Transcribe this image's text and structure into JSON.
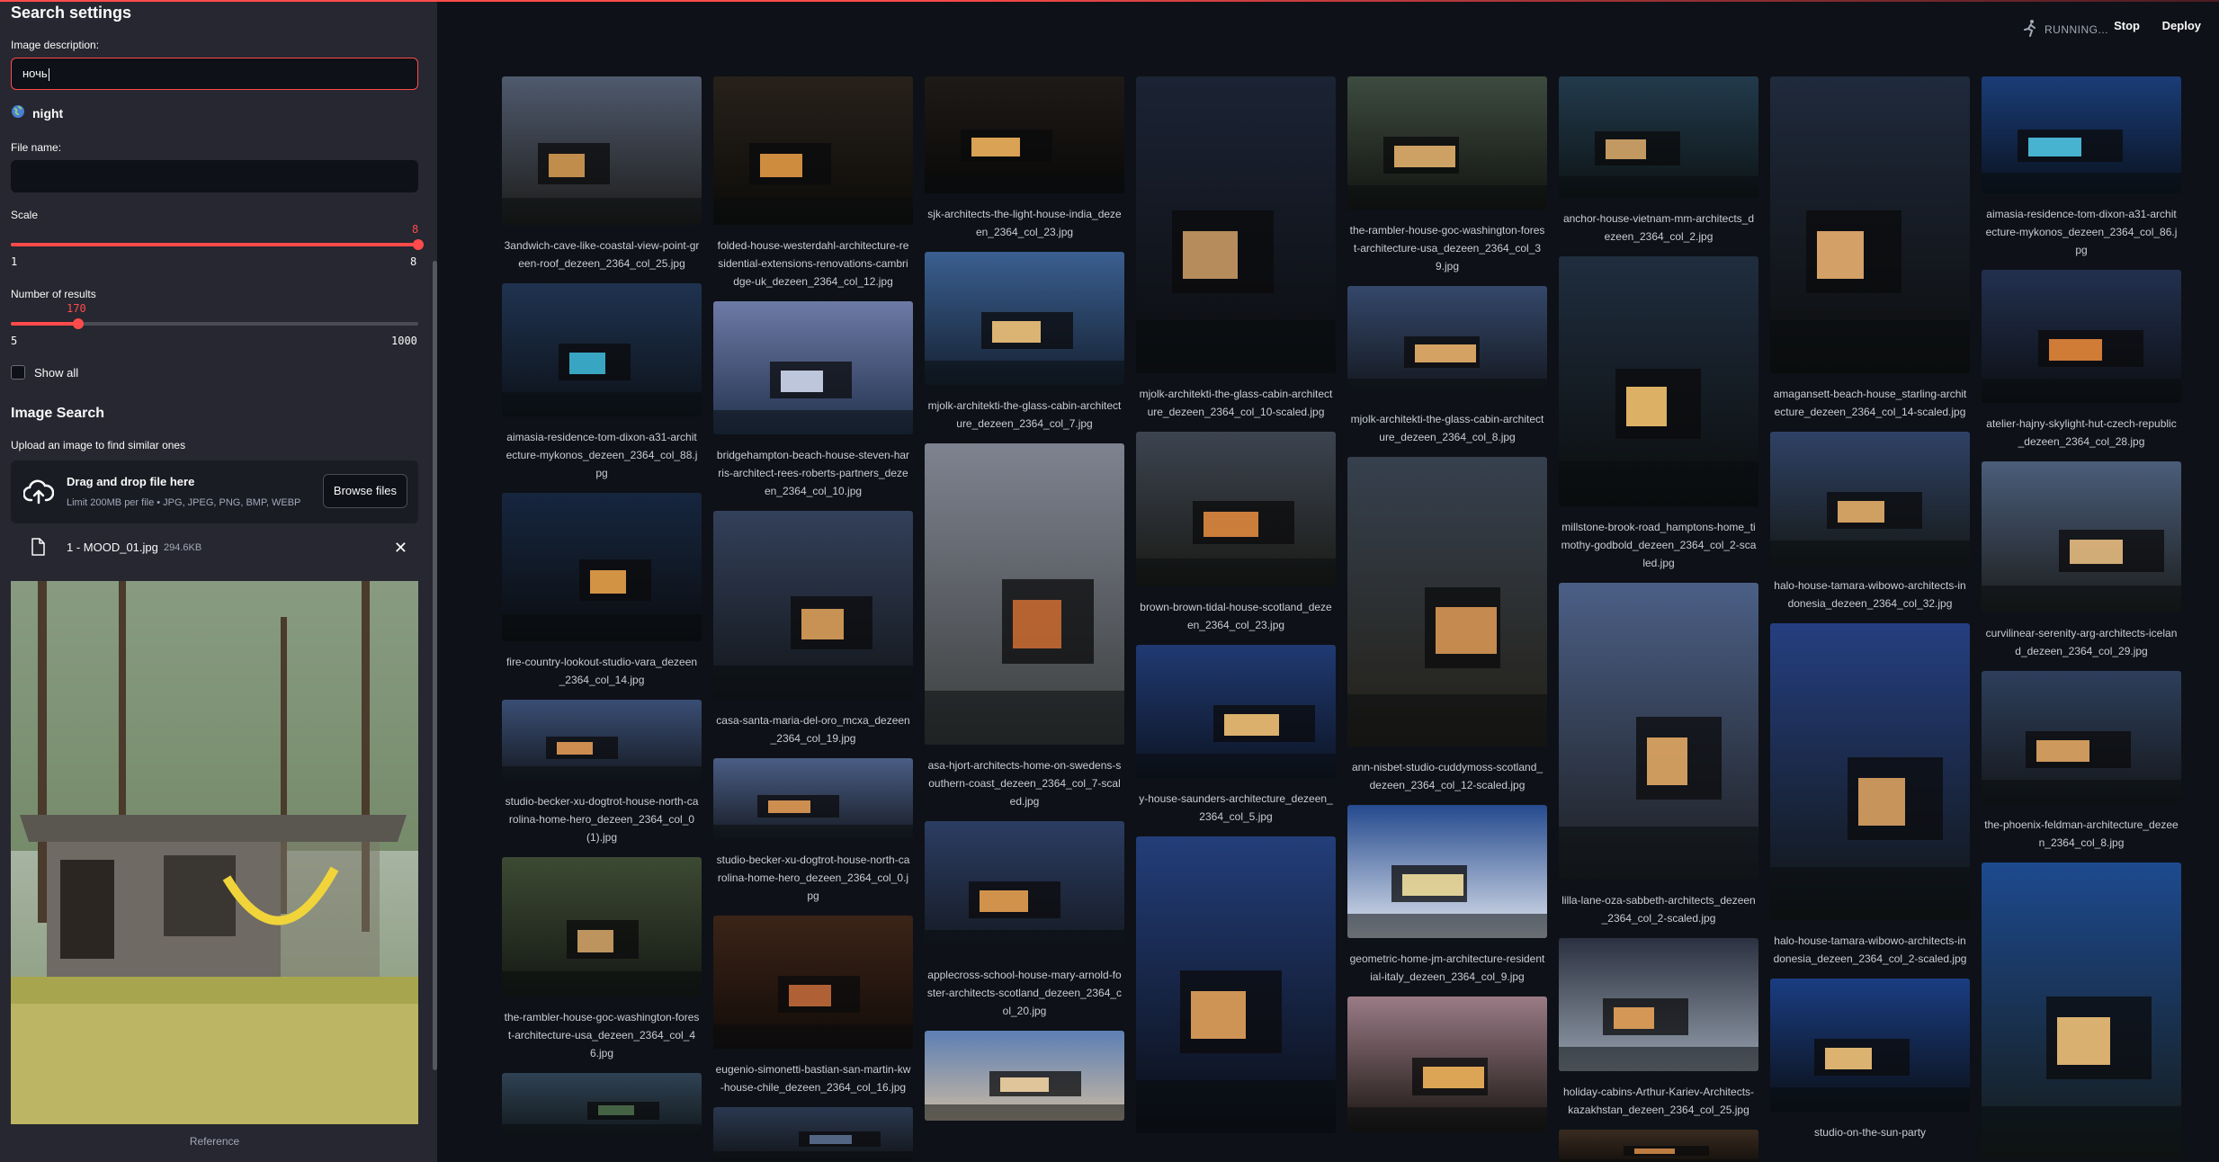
{
  "sidebar": {
    "title": "Search settings",
    "image_description_label": "Image description:",
    "image_description_value": "ночь",
    "suggestion": "night",
    "file_name_label": "File name:",
    "file_name_value": "",
    "scale": {
      "label": "Scale",
      "value": "8",
      "min": "1",
      "max": "8",
      "fraction": 1.0
    },
    "num_results": {
      "label": "Number of results",
      "value": "170",
      "min": "5",
      "max": "1000",
      "fraction": 0.166
    },
    "show_all_label": "Show all",
    "image_search_title": "Image Search",
    "upload_label": "Upload an image to find similar ones",
    "uploader_main": "Drag and drop file here",
    "uploader_sub": "Limit 200MB per file • JPG, JPEG, PNG, BMP, WEBP",
    "browse_label": "Browse files",
    "file": {
      "name": "1 - MOOD_01.jpg",
      "size": "294.6KB"
    },
    "reference_caption": "Reference"
  },
  "header": {
    "running_label": "RUNNING...",
    "stop_label": "Stop",
    "deploy_label": "Deploy"
  },
  "icons": {
    "suggestion": "globe-icon",
    "uploader": "cloud-upload-icon",
    "file": "file-icon",
    "remove": "close-icon",
    "running": "running-figure-icon"
  },
  "colors": {
    "accent": "#ff4b4b",
    "background": "#0e1117",
    "sidebar": "#262730"
  },
  "gallery": {
    "columns": [
      [
        {
          "caption": "3andwich-cave-like-coastal-view-point-green-roof_dezeen_2364_col_25.jpg",
          "h": 165,
          "c1": "#4f5a6e",
          "c2": "#1d1c1a",
          "glow": "#d49a52"
        },
        {
          "caption": "aimasia-residence-tom-dixon-a31-architecture-mykonos_dezeen_2364_col_88.jpg",
          "h": 148,
          "c1": "#1f3350",
          "c2": "#0c1118",
          "glow": "#3db6d6"
        },
        {
          "caption": "fire-country-lookout-studio-vara_dezeen_2364_col_14.jpg",
          "h": 165,
          "c1": "#16263f",
          "c2": "#0b0d10",
          "glow": "#e8a24b"
        },
        {
          "caption": "studio-becker-xu-dogtrot-house-north-carolina-home-hero_dezeen_2364_col_0 (1).jpg",
          "h": 90,
          "c1": "#3a4e74",
          "c2": "#151a22",
          "glow": "#e39b57"
        },
        {
          "caption": "the-rambler-house-goc-washington-forest-architecture-usa_dezeen_2364_col_46.jpg",
          "h": 155,
          "c1": "#3c4a33",
          "c2": "#151813",
          "glow": "#d0a366"
        },
        {
          "caption": "",
          "h": 70,
          "c1": "#2f4253",
          "c2": "#12181c",
          "glow": "#4b6b4a"
        }
      ],
      [
        {
          "caption": "folded-house-westerdahl-architecture-residential-extensions-renovations-cambridge-uk_dezeen_2364_col_12.jpg",
          "h": 165,
          "c1": "#27211a",
          "c2": "#0c0b09",
          "glow": "#e39a45"
        },
        {
          "caption": "bridgehampton-beach-house-steven-harris-architect-rees-roberts-partners_dezeen_2364_col_10.jpg",
          "h": 148,
          "c1": "#6d7aa6",
          "c2": "#22324e",
          "glow": "#cfd9ef"
        },
        {
          "caption": "casa-santa-maria-del-oro_mcxa_dezeen_2364_col_19.jpg",
          "h": 210,
          "c1": "#33405a",
          "c2": "#121519",
          "glow": "#dba15a"
        },
        {
          "caption": "studio-becker-xu-dogtrot-house-north-carolina-home-hero_dezeen_2364_col_0.jpg",
          "h": 90,
          "c1": "#4a5d85",
          "c2": "#171c24",
          "glow": "#e39b57"
        },
        {
          "caption": "eugenio-simonetti-bastian-san-martin-kw-house-chile_dezeen_2364_col_16.jpg",
          "h": 148,
          "c1": "#3b2418",
          "c2": "#120b08",
          "glow": "#c16a3a"
        },
        {
          "caption": "",
          "h": 60,
          "c1": "#2a3850",
          "c2": "#121519",
          "glow": "#5a6f8e"
        }
      ],
      [
        {
          "caption": "sjk-architects-the-light-house-india_dezeen_2364_col_23.jpg",
          "h": 130,
          "c1": "#1e1a17",
          "c2": "#0a0908",
          "glow": "#f0b25c"
        },
        {
          "caption": "mjolk-architekti-the-glass-cabin-architecture_dezeen_2364_col_7.jpg",
          "h": 148,
          "c1": "#3a5f90",
          "c2": "#152132",
          "glow": "#f2c47c"
        },
        {
          "caption": "asa-hjort-architects-home-on-swedens-southern-coast_dezeen_2364_col_7-scaled.jpg",
          "h": 335,
          "c1": "#7e8390",
          "c2": "#3b3d3c",
          "glow": "#c76a33"
        },
        {
          "caption": "applecross-school-house-mary-arnold-foster-architects-scotland_dezeen_2364_col_20.jpg",
          "h": 148,
          "c1": "#2b3d63",
          "c2": "#141820",
          "glow": "#e7a252"
        },
        {
          "caption": "",
          "h": 100,
          "c1": "#5d7fb4",
          "c2": "#c9b9a2",
          "glow": "#f4d6a6"
        }
      ],
      [
        {
          "caption": "mjolk-architekti-the-glass-cabin-architecture_dezeen_2364_col_10-scaled.jpg",
          "h": 330,
          "c1": "#1b2334",
          "c2": "#0c0d10",
          "glow": "#c99a66"
        },
        {
          "caption": "brown-brown-tidal-house-scotland_dezeen_2364_col_23.jpg",
          "h": 172,
          "c1": "#3c4450",
          "c2": "#1a1a16",
          "glow": "#e08a3f"
        },
        {
          "caption": "y-house-saunders-architecture_dezeen_2364_col_5.jpg",
          "h": 148,
          "c1": "#203a72",
          "c2": "#0d1423",
          "glow": "#f2c276"
        },
        {
          "caption": "",
          "h": 330,
          "c1": "#233e7a",
          "c2": "#0a0c12",
          "glow": "#e3a35d"
        }
      ],
      [
        {
          "caption": "the-rambler-house-goc-washington-forest-architecture-usa_dezeen_2364_col_39.jpg",
          "h": 148,
          "c1": "#3d4b3f",
          "c2": "#121410",
          "glow": "#e2b16d"
        },
        {
          "caption": "mjolk-architekti-the-glass-cabin-architecture_dezeen_2364_col_8.jpg",
          "h": 125,
          "c1": "#34486b",
          "c2": "#13161c",
          "glow": "#eab46c"
        },
        {
          "caption": "ann-nisbet-studio-cuddymoss-scotland_dezeen_2364_col_12-scaled.jpg",
          "h": 322,
          "c1": "#36404e",
          "c2": "#232017",
          "glow": "#d99855"
        },
        {
          "caption": "geometric-home-jm-architecture-residential-italy_dezeen_2364_col_9.jpg",
          "h": 148,
          "c1": "#254a8e",
          "c2": "#dfe5ef",
          "glow": "#f2e0a1"
        },
        {
          "caption": "",
          "h": 150,
          "c1": "#9a7b86",
          "c2": "#181410",
          "glow": "#f2b55c"
        }
      ],
      [
        {
          "caption": "anchor-house-vietnam-mm-architects_dezeen_2364_col_2.jpg",
          "h": 135,
          "c1": "#223a4c",
          "c2": "#0d1416",
          "glow": "#d7a86c"
        },
        {
          "caption": "millstone-brook-road_hamptons-home_timothy-godbold_dezeen_2364_col_2-scaled.jpg",
          "h": 278,
          "c1": "#1f2d3e",
          "c2": "#0b0d0d",
          "glow": "#f3c26f"
        },
        {
          "caption": "lilla-lane-oza-sabbeth-architects_dezeen_2364_col_2-scaled.jpg",
          "h": 330,
          "c1": "#4b5f86",
          "c2": "#1c1e21",
          "glow": "#e3aa66"
        },
        {
          "caption": "holiday-cabins-Arthur-Kariev-Architects-kazakhstan_dezeen_2364_col_25.jpg",
          "h": 148,
          "c1": "#2b3140",
          "c2": "#96a0ad",
          "glow": "#e8a45b"
        },
        {
          "caption": "",
          "h": 40,
          "c1": "#3a2b20",
          "c2": "#120e0b",
          "glow": "#d08a48"
        }
      ],
      [
        {
          "caption": "amagansett-beach-house_starling-architecture_dezeen_2364_col_14-scaled.jpg",
          "h": 330,
          "c1": "#1f2a3c",
          "c2": "#0d0d0d",
          "glow": "#e9b071"
        },
        {
          "caption": "halo-house-tamara-wibowo-architects-indonesia_dezeen_2364_col_32.jpg",
          "h": 148,
          "c1": "#2f4266",
          "c2": "#151918",
          "glow": "#e6b06c"
        },
        {
          "caption": "halo-house-tamara-wibowo-architects-indonesia_dezeen_2364_col_2-scaled.jpg",
          "h": 330,
          "c1": "#253f80",
          "c2": "#111412",
          "glow": "#dca364"
        },
        {
          "caption": "studio-on-the-sun-party",
          "h": 148,
          "c1": "#1a3d82",
          "c2": "#0b0f16",
          "glow": "#f2c47a"
        }
      ],
      [
        {
          "caption": "aimasia-residence-tom-dixon-a31-architecture-mykonos_dezeen_2364_col_86.jpg",
          "h": 130,
          "c1": "#1a3d78",
          "c2": "#0a1220",
          "glow": "#4ec5e6"
        },
        {
          "caption": "atelier-hajny-skylight-hut-czech-republic_dezeen_2364_col_28.jpg",
          "h": 148,
          "c1": "#22304f",
          "c2": "#0c0e12",
          "glow": "#e6883c"
        },
        {
          "caption": "curvilinear-serenity-arg-architects-iceland_dezeen_2364_col_29.jpg",
          "h": 168,
          "c1": "#4a5d7a",
          "c2": "#1c1d1c",
          "glow": "#e8bc82"
        },
        {
          "caption": "the-phoenix-feldman-architecture_dezeen_2364_col_8.jpg",
          "h": 148,
          "c1": "#2d3f5c",
          "c2": "#15171a",
          "glow": "#e3a864"
        },
        {
          "caption": "",
          "h": 330,
          "c1": "#1d4a8f",
          "c2": "#151a16",
          "glow": "#f0c27a"
        }
      ]
    ]
  }
}
